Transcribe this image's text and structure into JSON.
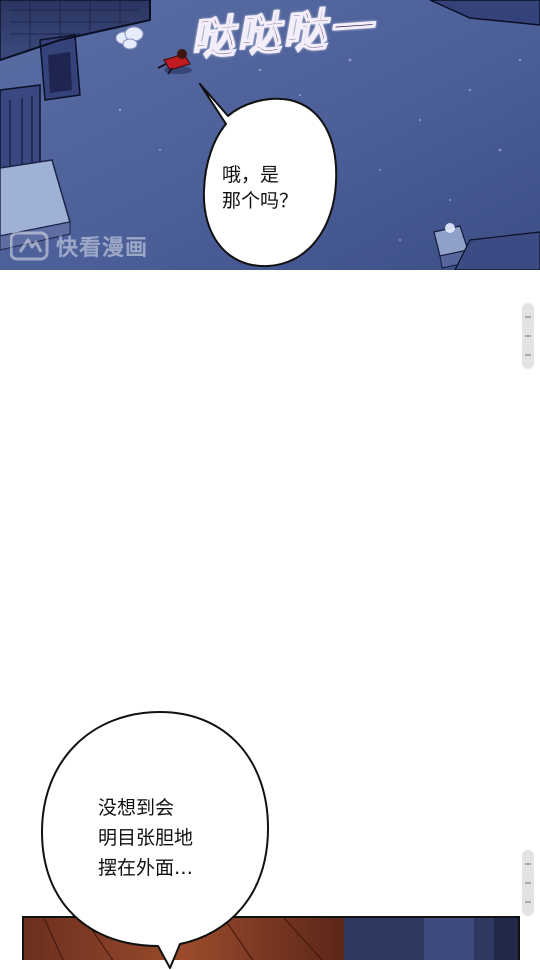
{
  "comic": {
    "sound_effect": "哒哒哒一",
    "watermark": {
      "brand_text": "快看漫画",
      "logo_icon": "kuaikan-logo-icon"
    },
    "bubbles": [
      {
        "lines": [
          "哦，是",
          "那个吗？"
        ]
      },
      {
        "lines": [
          "没想到会",
          "明目张胆地",
          "摆在外面…"
        ]
      }
    ]
  },
  "scroll_handles": [
    {
      "icon": "scroll-grip-icon"
    },
    {
      "icon": "scroll-grip-icon"
    }
  ],
  "colors": {
    "night_sky_ground": "#4a5c94",
    "rooftop_snow": "#8ea3c9",
    "sfx_purple": "#2a1b48",
    "character_red": "#c01a22"
  }
}
